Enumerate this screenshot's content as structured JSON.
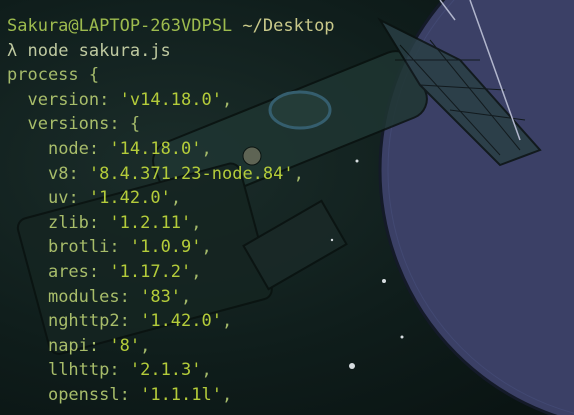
{
  "prompt": {
    "user_host": "Sakura@LAPTOP-263VDPSL",
    "cwd": "~/Desktop",
    "symbol": "λ",
    "command": "node sakura.js"
  },
  "output": {
    "open_line": "process {",
    "version_key": "version",
    "version_value": "'v14.18.0'",
    "versions_key": "versions",
    "versions": [
      {
        "key": "node",
        "value": "'14.18.0'"
      },
      {
        "key": "v8",
        "value": "'8.4.371.23-node.84'"
      },
      {
        "key": "uv",
        "value": "'1.42.0'"
      },
      {
        "key": "zlib",
        "value": "'1.2.11'"
      },
      {
        "key": "brotli",
        "value": "'1.0.9'"
      },
      {
        "key": "ares",
        "value": "'1.17.2'"
      },
      {
        "key": "modules",
        "value": "'83'"
      },
      {
        "key": "nghttp2",
        "value": "'1.42.0'"
      },
      {
        "key": "napi",
        "value": "'8'"
      },
      {
        "key": "llhttp",
        "value": "'2.1.3'"
      },
      {
        "key": "openssl",
        "value": "'1.1.1l'"
      }
    ]
  },
  "colors": {
    "background": "#0f1d1b",
    "text": "#a5bb6b",
    "string": "#b4cc3a",
    "planet": "#3a3f63"
  },
  "wallpaper": {
    "description_icon": "satellite-planet-wallpaper"
  }
}
